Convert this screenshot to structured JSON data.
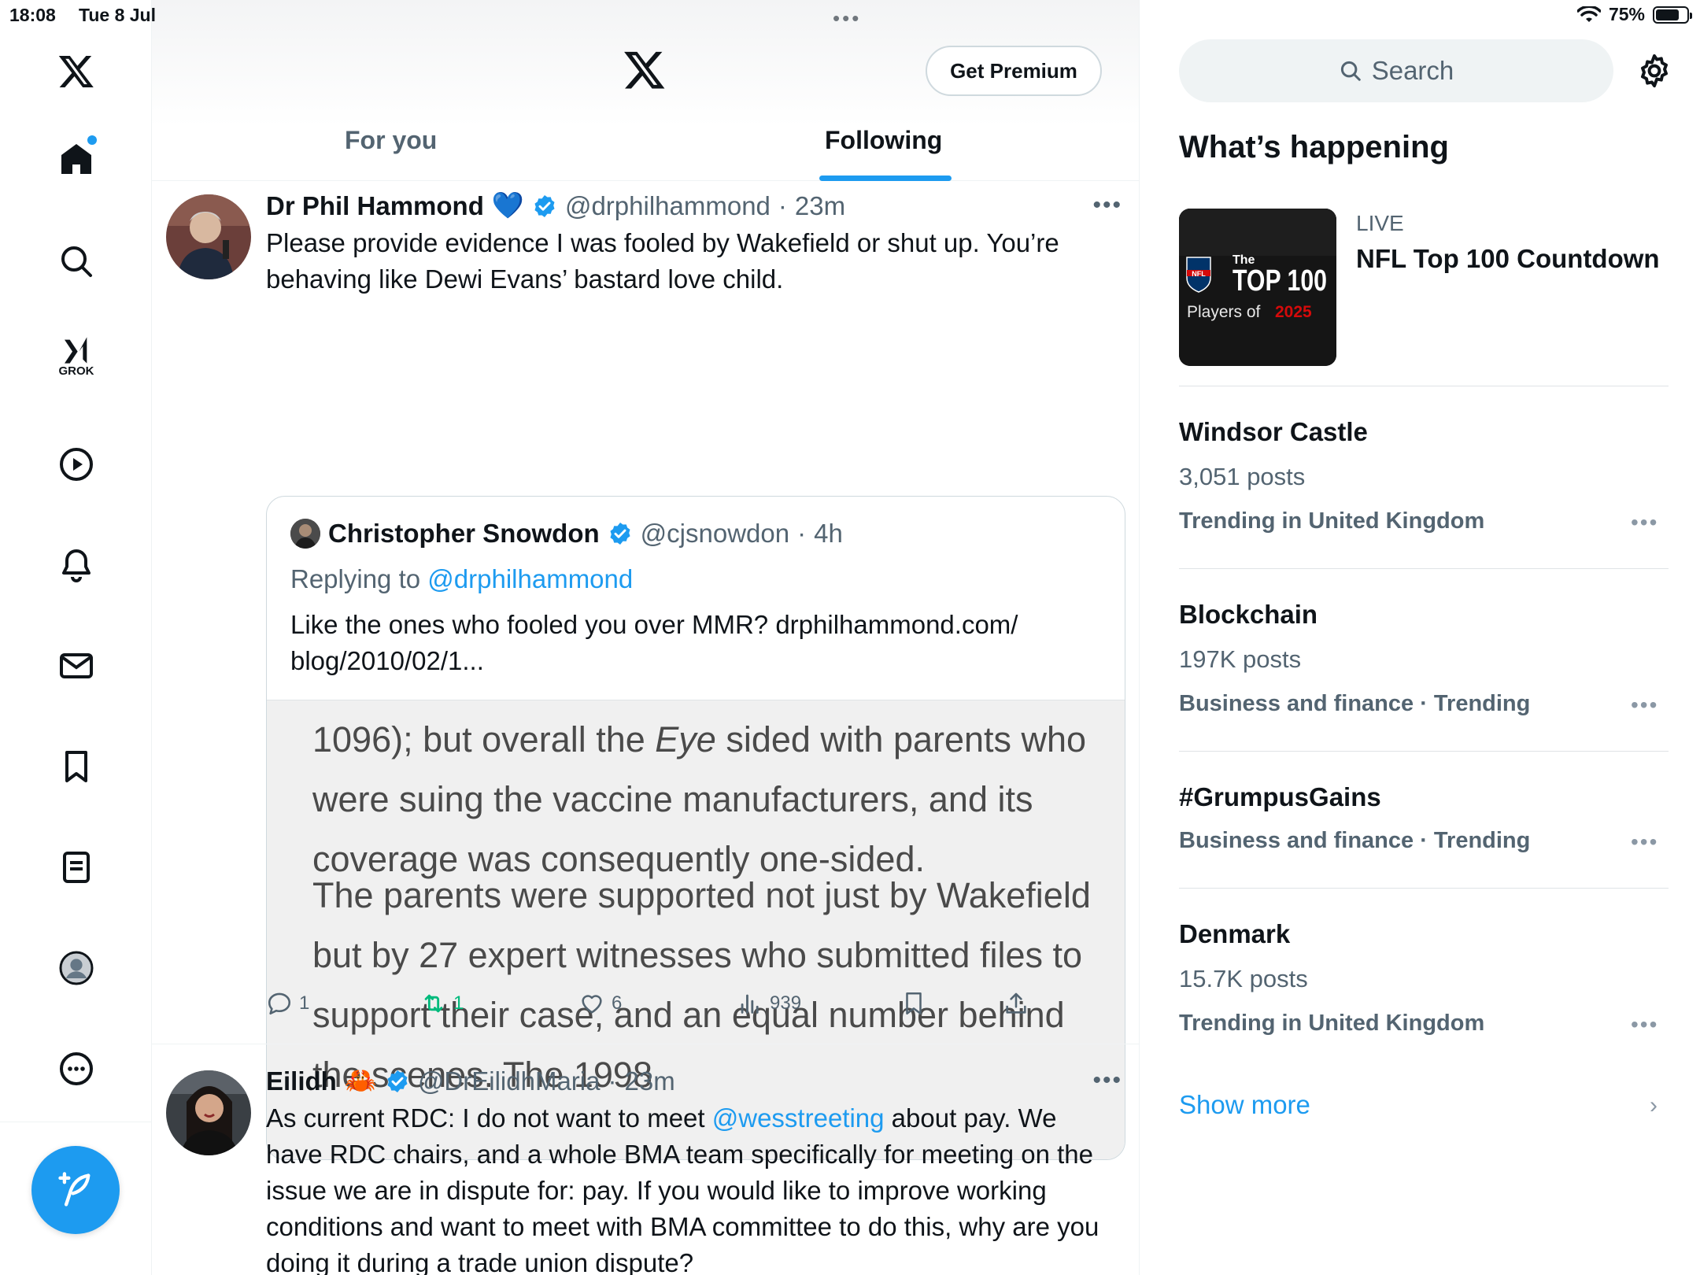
{
  "status_bar": {
    "time": "18:08",
    "date": "Tue 8 Jul",
    "battery": "75%",
    "battery_level": 0.75
  },
  "nav": {
    "grok_label": "GROK",
    "items": [
      "home-icon",
      "search-icon",
      "grok-icon",
      "video-icon",
      "bell-icon",
      "mail-icon",
      "bookmark-icon",
      "list-icon",
      "profile-icon",
      "more-icon"
    ]
  },
  "header": {
    "premium_label": "Get Premium",
    "tabs": [
      {
        "label": "For you",
        "active": false
      },
      {
        "label": "Following",
        "active": true
      }
    ]
  },
  "tweets": [
    {
      "name": "Dr Phil Hammond",
      "emoji": "💙",
      "handle": "@drphilhammond",
      "sep": "·",
      "time": "23m",
      "text": "Please provide evidence I was fooled by Wakefield or shut up. You’re behaving like Dewi Evans’ bastard love child.",
      "quote": {
        "name": "Christopher Snowdon",
        "handle": "@cjsnowdon",
        "sep": "·",
        "time": "4h",
        "replying_prefix": "Replying to",
        "replying_to": "@drphilhammond",
        "text_line1": "Like the ones who fooled you over MMR? drphilhammond.com/",
        "text_line2": "blog/2010/02/1...",
        "image_para1_a": "1096); but overall the ",
        "image_para1_italic": "Eye",
        "image_para1_b": " sided with parents who were suing the vaccine manufacturers, and its coverage was consequently one-sided.",
        "image_para2": "The parents were supported not just by Wakefield but by 27 expert witnesses who submitted files to support their case, and an equal number behind the scenes. The 1998"
      },
      "stats": {
        "replies": "1",
        "reposts": "1",
        "likes": "6",
        "views": "939"
      }
    },
    {
      "name": "Eilidh",
      "emoji": "🦀",
      "handle": "@DrEilidhMaria",
      "sep": "·",
      "time": "23m",
      "text_a": "As current RDC: I do not want to meet ",
      "mention": "@wesstreeting",
      "text_b": " about pay. We have RDC chairs, and a whole BMA team specifically for meeting on the issue we are in dispute for: pay. If you would like to improve working conditions and want to meet with BMA committee to do this, why are you doing it during a trade union dispute?"
    }
  ],
  "sidebar": {
    "search_placeholder": "Search",
    "heading": "What’s happening",
    "live": {
      "label": "LIVE",
      "title": "NFL Top 100 Countdown",
      "image_line1": "The",
      "image_line2": "TOP 100",
      "image_line3": "Players of",
      "image_year": "2025",
      "image_badge": "NFL"
    },
    "trends": [
      {
        "title": "Windsor Castle",
        "posts": "3,051 posts",
        "category": "Trending in United Kingdom"
      },
      {
        "title": "Blockchain",
        "posts": "197K posts",
        "category": "Business and finance · Trending"
      },
      {
        "title": "#GrumpusGains",
        "posts": "",
        "category": "Business and finance · Trending"
      },
      {
        "title": "Denmark",
        "posts": "15.7K posts",
        "category": "Trending in United Kingdom"
      }
    ],
    "show_more": "Show more"
  },
  "colors": {
    "accent": "#1d9bf0",
    "repost": "#00ba7c",
    "secondary_text": "#536471"
  }
}
